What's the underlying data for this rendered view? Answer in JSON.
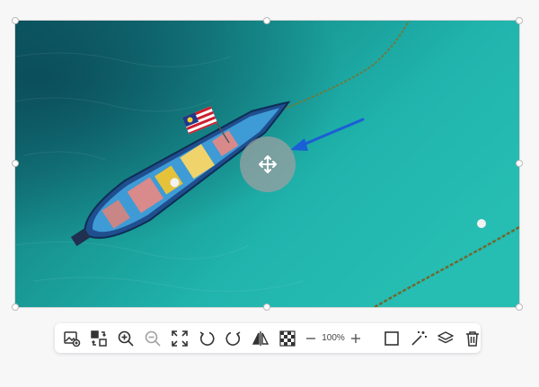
{
  "toolbar": {
    "zoom_level": "100%",
    "buttons": [
      {
        "icon": "replace-image-icon"
      },
      {
        "icon": "swap-image-icon"
      },
      {
        "icon": "zoom-in-icon"
      },
      {
        "icon": "zoom-out-icon"
      },
      {
        "icon": "fit-screen-icon"
      },
      {
        "icon": "rotate-left-icon"
      },
      {
        "icon": "rotate-right-icon"
      },
      {
        "icon": "flip-horizontal-icon"
      },
      {
        "icon": "transparency-icon"
      },
      {
        "icon": "zoom-decrease-icon"
      },
      {
        "icon": "zoom-increase-icon"
      },
      {
        "icon": "crop-icon"
      },
      {
        "icon": "magic-wand-icon"
      },
      {
        "icon": "layers-icon"
      },
      {
        "icon": "delete-icon"
      }
    ]
  },
  "colors": {
    "sea": "#1fb3ad",
    "sea_dark": "#0f5e69",
    "annotation_arrow": "#1a5fd6",
    "icon": "#333333"
  },
  "image": {
    "subject": "boat-photo"
  }
}
